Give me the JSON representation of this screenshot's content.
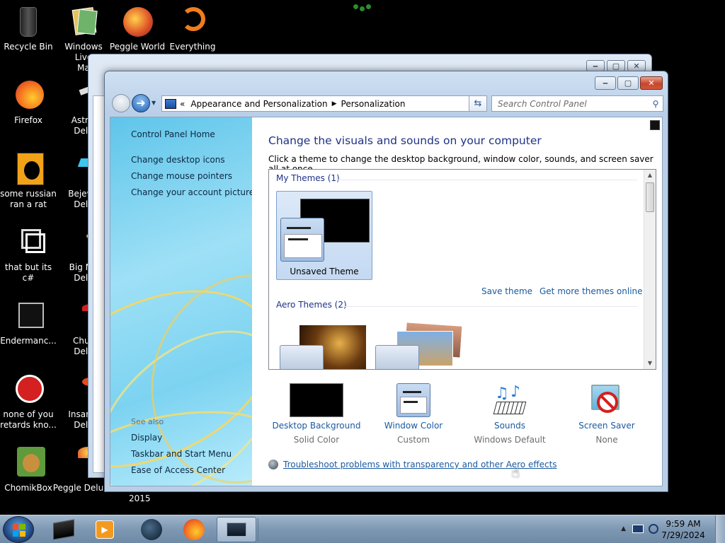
{
  "desktop": {
    "icons": [
      {
        "label": "Recycle Bin",
        "icon": "recycle-bin-icon"
      },
      {
        "label": "Windows Live\nMa",
        "icon": "windows-live-icon"
      },
      {
        "label": "Peggle World",
        "icon": "peggle-icon"
      },
      {
        "label": "Everything",
        "icon": "everything-icon"
      },
      {
        "label": "Firefox",
        "icon": "firefox-icon"
      },
      {
        "label": "Astrol\nDelu",
        "icon": "astropop-icon"
      },
      {
        "label": "some russian\nran a rat",
        "icon": "app-icon"
      },
      {
        "label": "Bejewe\nDelu",
        "icon": "bejeweled-icon"
      },
      {
        "label": "that but its c#",
        "icon": "shortcut-icon"
      },
      {
        "label": "Big Mo\nDelu",
        "icon": "bigmoney-icon"
      },
      {
        "label": "Endermanc...",
        "icon": "console-icon"
      },
      {
        "label": "Chuz\nDelu",
        "icon": "chuzzle-icon"
      },
      {
        "label": "none of you\nretards kno...",
        "icon": "app-icon"
      },
      {
        "label": "Insaniq\nDelu",
        "icon": "insaniquarium-icon"
      },
      {
        "label": "ChomikBox",
        "icon": "chomikbox-icon"
      },
      {
        "label": "Peggle Delux",
        "icon": "peggle-icon"
      }
    ],
    "year_label": "2015"
  },
  "window": {
    "caption": {
      "minimize": "‒",
      "maximize": "▢",
      "close": "✕"
    },
    "breadcrumb": {
      "prefix": "«",
      "items": [
        "Appearance and Personalization",
        "Personalization"
      ]
    },
    "search": {
      "placeholder": "Search Control Panel"
    },
    "left_pane": {
      "home": "Control Panel Home",
      "links": [
        "Change desktop icons",
        "Change mouse pointers",
        "Change your account picture"
      ],
      "see_also_label": "See also",
      "see_also": [
        "Display",
        "Taskbar and Start Menu",
        "Ease of Access Center"
      ]
    },
    "main": {
      "title": "Change the visuals and sounds on your computer",
      "subtitle": "Click a theme to change the desktop background, window color, sounds, and screen saver all at once.",
      "my_themes_header": "My Themes (1)",
      "unsaved_theme": "Unsaved Theme",
      "save_theme": "Save theme",
      "more_themes": "Get more themes online",
      "aero_themes_header": "Aero Themes (2)",
      "bottom": [
        {
          "label": "Desktop Background",
          "value": "Solid Color"
        },
        {
          "label": "Window Color",
          "value": "Custom"
        },
        {
          "label": "Sounds",
          "value": "Windows Default"
        },
        {
          "label": "Screen Saver",
          "value": "None"
        }
      ],
      "troubleshoot": "Troubleshoot problems with transparency and other Aero effects"
    }
  },
  "taskbar": {
    "time": "9:59 AM",
    "date": "7/29/2024"
  }
}
